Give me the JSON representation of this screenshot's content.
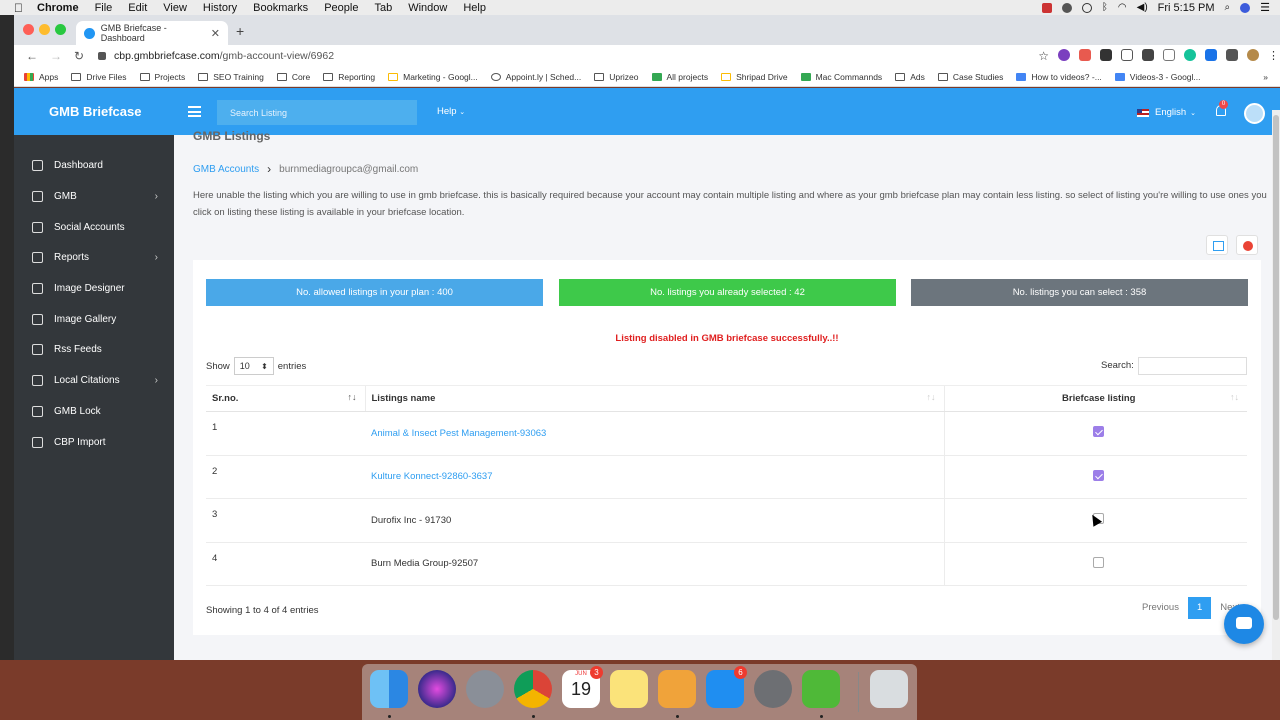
{
  "menubar": {
    "items": [
      "Chrome",
      "File",
      "Edit",
      "View",
      "History",
      "Bookmarks",
      "People",
      "Tab",
      "Window",
      "Help"
    ],
    "clock": "Fri 5:15 PM"
  },
  "browser": {
    "tab_title": "GMB Briefcase - Dashboard",
    "url_host": "cbp.gmbbriefcase.com",
    "url_path": "/gmb-account-view/6962",
    "bookmarks": [
      "Apps",
      "Drive Files",
      "Projects",
      "SEO Training",
      "Core",
      "Reporting",
      "Marketing - Googl...",
      "Appoint.ly | Sched...",
      "Uprizeo",
      "All projects",
      "Shripad Drive",
      "Mac Commannds",
      "Ads",
      "Case Studies",
      "How to videos? -...",
      "Videos-3 - Googl..."
    ]
  },
  "header": {
    "brand": "GMB Briefcase",
    "search_placeholder": "Search Listing",
    "help": "Help",
    "language": "English",
    "notif_count": "0"
  },
  "sidebar": {
    "items": [
      {
        "label": "Dashboard",
        "icon": "dashboard-icon",
        "chevron": false
      },
      {
        "label": "GMB",
        "icon": "gmb-icon",
        "chevron": true
      },
      {
        "label": "Social Accounts",
        "icon": "social-icon",
        "chevron": false
      },
      {
        "label": "Reports",
        "icon": "reports-icon",
        "chevron": true
      },
      {
        "label": "Image Designer",
        "icon": "image-designer-icon",
        "chevron": false
      },
      {
        "label": "Image Gallery",
        "icon": "image-gallery-icon",
        "chevron": false
      },
      {
        "label": "Rss Feeds",
        "icon": "rss-icon",
        "chevron": false
      },
      {
        "label": "Local Citations",
        "icon": "citations-icon",
        "chevron": true
      },
      {
        "label": "GMB Lock",
        "icon": "lock-icon",
        "chevron": false
      },
      {
        "label": "CBP Import",
        "icon": "import-icon",
        "chevron": false
      }
    ]
  },
  "page": {
    "title": "GMB Listings",
    "breadcrumb_root": "GMB Accounts",
    "breadcrumb_current": "burnmediagroupca@gmail.com",
    "description": "Here unable the listing which you are willing to use in gmb briefcase. this is basically required because your account may contain multiple listing and where as your gmb briefcase plan may contain less listing. so select of listing you're willing to use ones you click on listing these listing is available in your briefcase location.",
    "stats": {
      "allowed": "No. allowed listings in your plan : 400",
      "selected": "No. listings you already selected : 42",
      "can_select": "No. listings you can select : 358"
    },
    "message": "Listing disabled in GMB briefcase successfully..!!",
    "show_label": "Show",
    "entries_value": "10",
    "entries_label": "entries",
    "search_label": "Search:",
    "columns": [
      "Sr.no.",
      "Listings name",
      "Briefcase listing"
    ],
    "rows": [
      {
        "sr": "1",
        "name": "Animal & Insect Pest Management-93063",
        "linked": true,
        "checked": true
      },
      {
        "sr": "2",
        "name": "Kulture Konnect-92860-3637",
        "linked": true,
        "checked": true
      },
      {
        "sr": "3",
        "name": "Durofix Inc - 91730",
        "linked": false,
        "checked": false
      },
      {
        "sr": "4",
        "name": "Burn Media Group-92507",
        "linked": false,
        "checked": false
      }
    ],
    "showing": "Showing 1 to 4 of 4 entries",
    "pager": {
      "prev": "Previous",
      "page": "1",
      "next": "Next"
    }
  },
  "dock": {
    "calendar_month": "JUN",
    "calendar_day": "19",
    "calendar_badge": "3",
    "appstore_badge": "6"
  },
  "colors": {
    "primary": "#2f9ef1",
    "stat_allowed": "#4aa8e8",
    "stat_selected": "#3ec94a",
    "stat_can_select": "#6c757d",
    "sidebar": "#33373b",
    "message": "#e02020"
  }
}
